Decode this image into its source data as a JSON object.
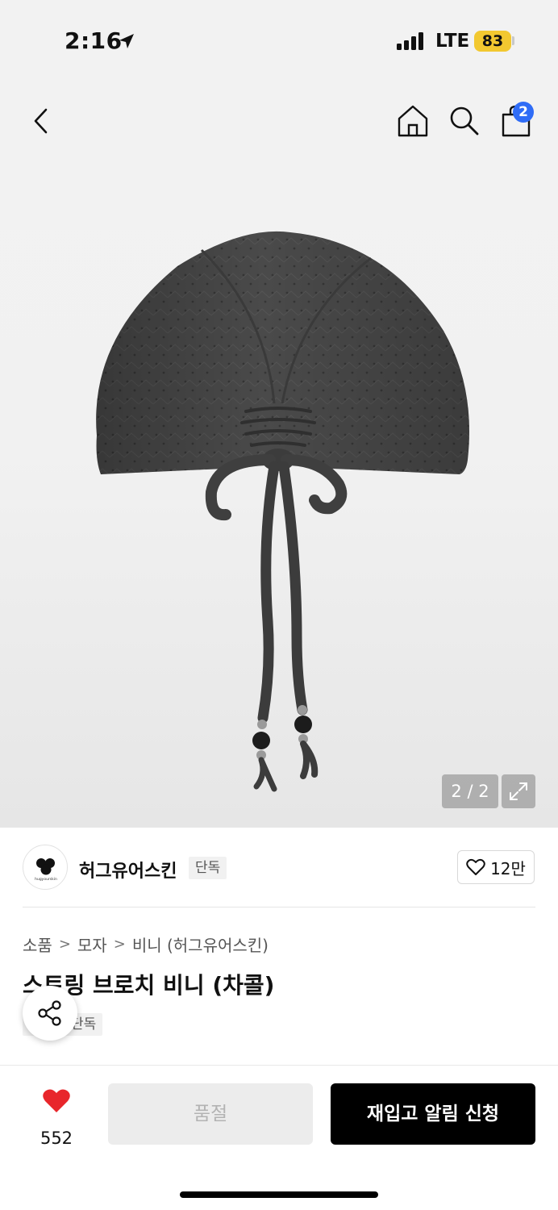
{
  "status_bar": {
    "time": "2:16",
    "carrier": "LTE",
    "battery": "83",
    "battery_color": "#f2c830"
  },
  "nav": {
    "back_icon": "chevron-left-icon",
    "home_icon": "home-icon",
    "search_icon": "search-icon",
    "bag_icon": "shopping-bag-icon",
    "cart_count": "2",
    "badge_color": "#2f6cf6"
  },
  "gallery": {
    "counter": "2 / 2",
    "expand_icon": "expand-icon"
  },
  "brand": {
    "name": "허그유어스킨",
    "tag": "단독",
    "logo_text": "hugyourskin",
    "like_count": "12만"
  },
  "breadcrumb": [
    "소품",
    "모자",
    "비니 (허그유어스킨)"
  ],
  "product": {
    "title": "스트링 브로치 비니 (차콜)",
    "exclusive_tag": "단독"
  },
  "action_bar": {
    "wish_count": "552",
    "wish_color": "#e8262b",
    "soldout_label": "품절",
    "restock_label": "재입고 알림 신청"
  }
}
